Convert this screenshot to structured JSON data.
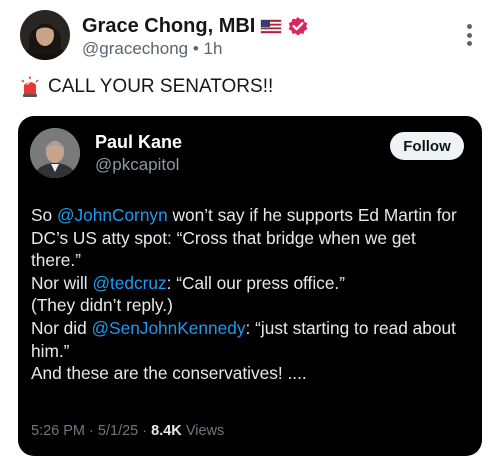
{
  "post": {
    "author_name": "Grace Chong, MBI",
    "flag_icon": "us-flag-icon",
    "verified_icon": "verified-badge-icon",
    "handle": "@gracechong",
    "separator": "•",
    "time": "1h",
    "text": "CALL YOUR SENATORS!!",
    "emoji_icon": "police-siren-icon",
    "more_icon": "vertical-dots-icon"
  },
  "quote": {
    "name": "Paul Kane",
    "handle": "@pkcapitol",
    "follow_label": "Follow",
    "lines": [
      [
        {
          "t": "So "
        },
        {
          "t": "@JohnCornyn",
          "m": true
        },
        {
          "t": " won’t say if he supports Ed Martin for"
        }
      ],
      [
        {
          "t": "DC’s US atty spot: “Cross that bridge when we get"
        }
      ],
      [
        {
          "t": "there.”"
        }
      ],
      [
        {
          "t": "Nor will "
        },
        {
          "t": "@tedcruz",
          "m": true
        },
        {
          "t": ": “Call our press office.”"
        }
      ],
      [
        {
          "t": "(They didn’t reply.)"
        }
      ],
      [
        {
          "t": "Nor did "
        },
        {
          "t": "@SenJohnKennedy",
          "m": true
        },
        {
          "t": ": “just starting to read about"
        }
      ],
      [
        {
          "t": "him.”"
        }
      ],
      [
        {
          "t": "And these are the conservatives! ...."
        }
      ]
    ],
    "footer": {
      "time": "5:26 PM",
      "dot": "·",
      "date": "5/1/25",
      "views_count": "8.4K",
      "views_label": "Views"
    }
  },
  "colors": {
    "mention": "#1d9bf0",
    "card_bg": "#000000",
    "verified": "#e0245e"
  }
}
